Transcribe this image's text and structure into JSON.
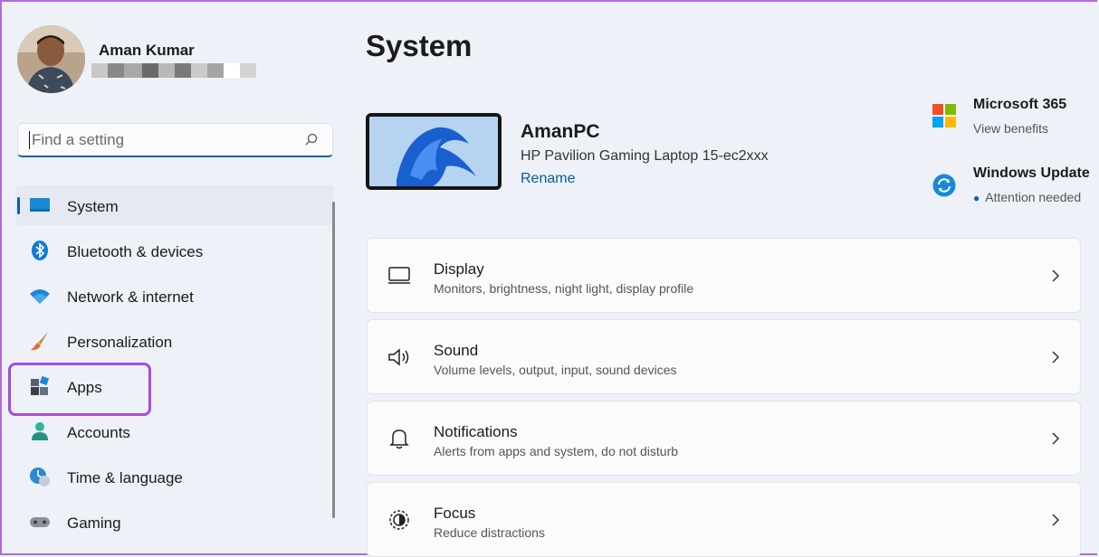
{
  "profile": {
    "name": "Aman Kumar",
    "email_redacted_colors": [
      "#c8c8c8",
      "#888888",
      "#a8a8a8",
      "#6a6a6a",
      "#b8b8b8",
      "#7a7a7a",
      "#cacaca",
      "#a5a5a5",
      "#ffffff",
      "#d3d3d3"
    ]
  },
  "search": {
    "placeholder": "Find a setting",
    "icon": "search-icon"
  },
  "nav": {
    "items": [
      {
        "label": "System",
        "icon": "system-icon",
        "active": true
      },
      {
        "label": "Bluetooth & devices",
        "icon": "bluetooth-icon"
      },
      {
        "label": "Network & internet",
        "icon": "wifi-icon"
      },
      {
        "label": "Personalization",
        "icon": "brush-icon"
      },
      {
        "label": "Apps",
        "icon": "apps-icon",
        "highlighted": true
      },
      {
        "label": "Accounts",
        "icon": "accounts-icon"
      },
      {
        "label": "Time & language",
        "icon": "time-language-icon"
      },
      {
        "label": "Gaming",
        "icon": "gaming-icon"
      }
    ]
  },
  "main": {
    "title": "System",
    "device": {
      "name": "AmanPC",
      "model": "HP Pavilion Gaming Laptop 15-ec2xxx",
      "rename_label": "Rename"
    },
    "ms365": {
      "title": "Microsoft 365",
      "subtitle": "View benefits"
    },
    "windows_update": {
      "title": "Windows Update",
      "subtitle": "Attention needed"
    },
    "cards": [
      {
        "title": "Display",
        "subtitle": "Monitors, brightness, night light, display profile",
        "icon": "display-icon"
      },
      {
        "title": "Sound",
        "subtitle": "Volume levels, output, input, sound devices",
        "icon": "speaker-icon"
      },
      {
        "title": "Notifications",
        "subtitle": "Alerts from apps and system, do not disturb",
        "icon": "bell-icon"
      },
      {
        "title": "Focus",
        "subtitle": "Reduce distractions",
        "icon": "focus-icon"
      }
    ]
  },
  "colors": {
    "accent": "#0a5dbd",
    "highlight": "#a24de0",
    "background": "#eef1f8"
  }
}
